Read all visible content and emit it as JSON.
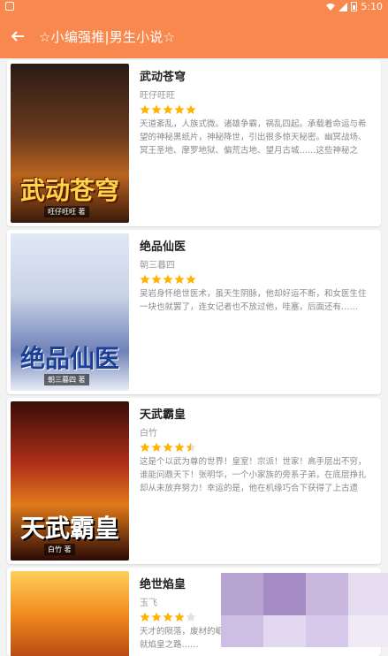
{
  "status": {
    "time": "5:10"
  },
  "header": {
    "title": "☆小编强推|男生小说☆"
  },
  "books": [
    {
      "title": "武动苍穹",
      "author": "旺仔旺旺",
      "stars": 5,
      "cover_text": "武动苍穹",
      "cover_author": "旺仔旺旺 著",
      "desc": "天道紊乱，人族式微。诸雄争霸，祸乱四起。承载着命运与希望的神秘黑纸片，神秘降世，引出很多惊天秘密。幽冥战场、冥王圣地、摩罗地狱、偏荒古地、望月古城……这些神秘之地……"
    },
    {
      "title": "绝品仙医",
      "author": "朝三暮四",
      "stars": 5,
      "cover_text": "绝品仙医",
      "cover_author": "朝三暮四 著",
      "desc": "吴岩身怀绝世医术，虽天生阴脉，他却好运不断，和女医生住一块也就罢了，连女记者也不放过他，哇塞，后面还有……"
    },
    {
      "title": "天武霸皇",
      "author": "白竹",
      "stars": 4.5,
      "cover_text": "天武霸皇",
      "cover_author": "白竹 著",
      "desc": "这是个以武为尊的世界！皇室！宗派！世家！高手层出不穷，谁能问鼎天下！张明华，一个小家族的旁系子弟，在底层挣扎却从未放弃努力！幸运的是，他在机缘巧合下获得了上古遗留……"
    },
    {
      "title": "绝世焰皇",
      "author": "玉飞",
      "stars": 4,
      "cover_text": "",
      "cover_author": "",
      "desc": "天才的陨落，废材的崛起，机缘巧合下获得神秘传承，从此成就焰皇之路……"
    }
  ],
  "colors": {
    "accent": "#f9884e",
    "star": "#ffb300"
  }
}
